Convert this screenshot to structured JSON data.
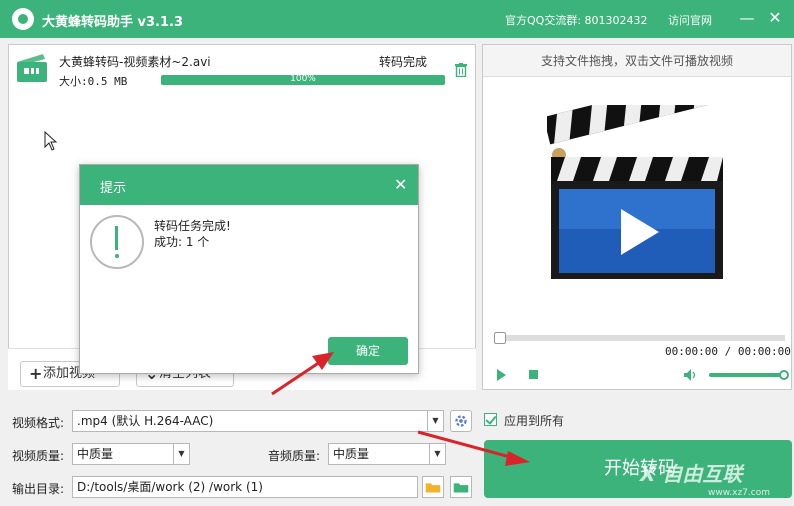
{
  "titlebar": {
    "app_title": "大黄蜂转码助手 v3.1.3",
    "qq_group": "官方QQ交流群: 801302432",
    "site_link": "访问官网",
    "min_glyph": "—",
    "close_glyph": "✕"
  },
  "file_list": {
    "items": [
      {
        "name": "大黄蜂转码-视频素材~2.avi",
        "status": "转码完成",
        "size": "大小:0.5 MB",
        "progress_label": "100%",
        "progress": 1.0
      }
    ]
  },
  "panel_buttons": {
    "add_icon": "+",
    "add_label": "添加视频",
    "clear_icon": "⌄",
    "clear_label": "清空列表"
  },
  "preview": {
    "hint": "支持文件拖拽，双击文件可播放视频",
    "time": "00:00:00 / 00:00:00",
    "seek_position": 0,
    "volume_level": 1.0
  },
  "settings": {
    "format_label": "视频格式:",
    "format_value": ".mp4 (默认 H.264-AAC)",
    "apply_all_label": "应用到所有",
    "apply_all_checked": true,
    "video_quality_label": "视频质量:",
    "video_quality_value": "中质量",
    "audio_quality_label": "音频质量:",
    "audio_quality_value": "中质量",
    "output_label": "输出目录:",
    "output_value": "D:/tools/桌面/work (2) /work (1)",
    "select_arrow": "▼",
    "start_label": "开始转码"
  },
  "watermark": {
    "text": "X 自由互联",
    "url": "www.xz7.com"
  },
  "dialog": {
    "title": "提示",
    "close_glyph": "✕",
    "message": "转码任务完成!",
    "count": "成功:  1 个",
    "ok_label": "确定"
  },
  "colors": {
    "accent": "#3bb37a",
    "arrow": "#d8242a"
  },
  "icons": [
    "app-logo-icon",
    "video-file-icon",
    "trash-icon",
    "clapperboard-icon",
    "play-icon",
    "stop-icon",
    "volume-icon",
    "settings-icon",
    "folder-open-icon",
    "folder-change-icon",
    "alert-icon",
    "mouse-cursor-icon"
  ]
}
